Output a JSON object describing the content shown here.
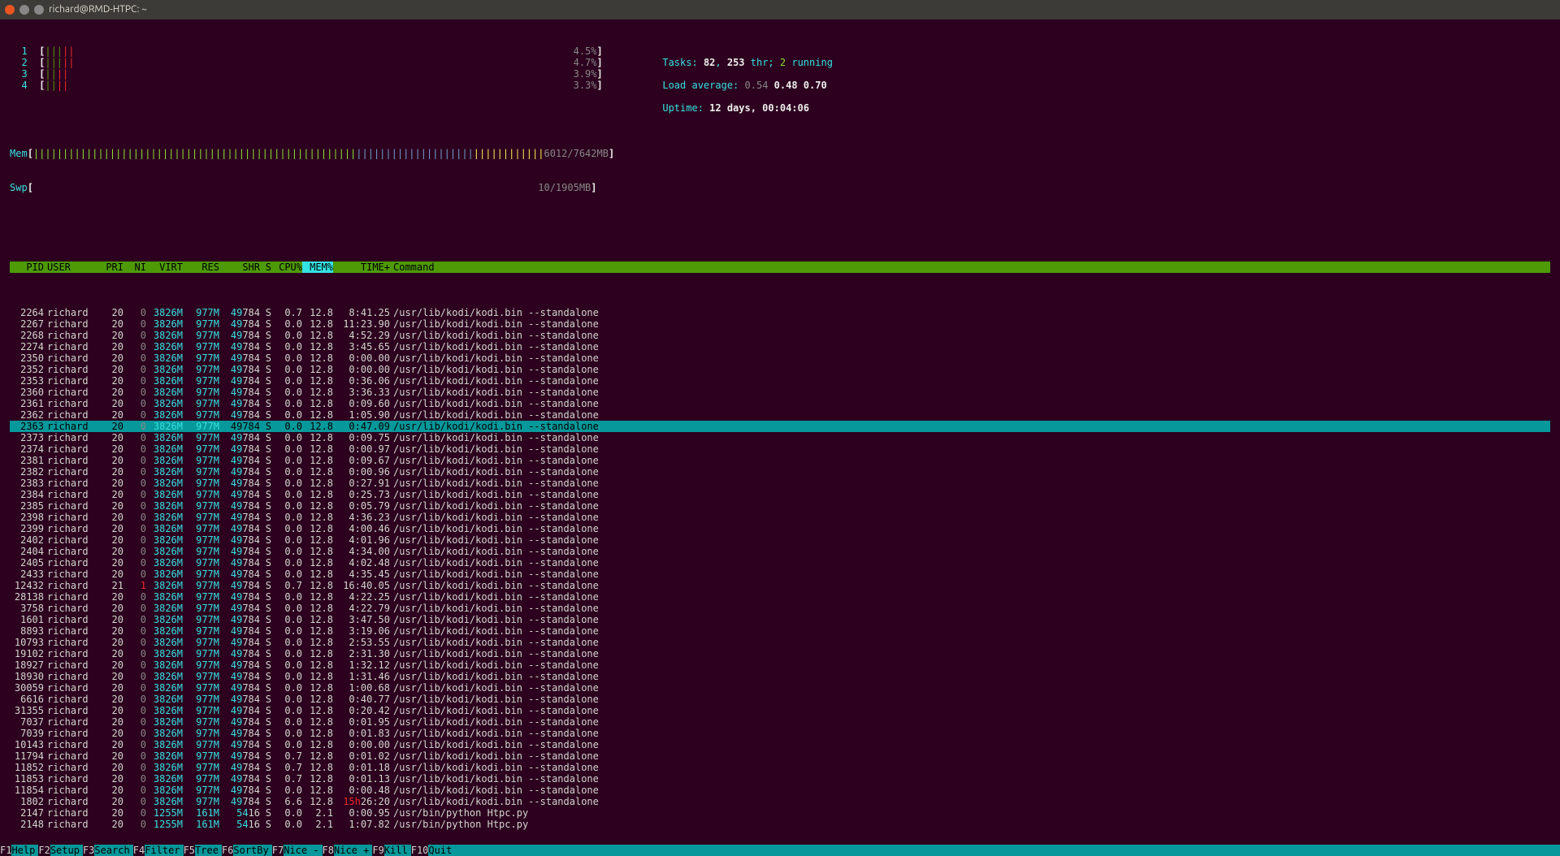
{
  "window": {
    "title": "richard@RMD-HTPC: ~"
  },
  "meters": {
    "cpus": [
      {
        "num": "1",
        "bars": "|||||",
        "pct": "4.5%"
      },
      {
        "num": "2",
        "bars": "|||||",
        "pct": "4.7%"
      },
      {
        "num": "3",
        "bars": "||||",
        "pct": "3.9%"
      },
      {
        "num": "4",
        "bars": "||||",
        "pct": "3.3%"
      }
    ],
    "mem": {
      "label": "Mem",
      "val": "6012/7642MB"
    },
    "swp": {
      "label": "Swp",
      "val": "10/1905MB"
    },
    "tasks": {
      "label": "Tasks: ",
      "total": "82",
      "sep": ", ",
      "thr": "253",
      "thrlbl": " thr; ",
      "run": "2",
      "runlbl": " running"
    },
    "load": {
      "label": "Load average: ",
      "l1": "0.54",
      "l2": "0.48",
      "l3": "0.70"
    },
    "uptime": {
      "label": "Uptime: ",
      "val": "12 days, 00:04:06"
    }
  },
  "headers": {
    "pid": "PID",
    "user": "USER",
    "pri": "PRI",
    "ni": "NI",
    "virt": "VIRT",
    "res": "RES",
    "shr": "SHR",
    "s": "S",
    "cpu": "CPU%",
    "mem": "MEM%",
    "time": "TIME+",
    "cmd": "Command"
  },
  "processes": [
    {
      "pid": "2264",
      "user": "richard",
      "pri": "20",
      "ni": "0",
      "virt": "3826M",
      "res": "977M",
      "shr": "49784",
      "s": "S",
      "cpu": "0.7",
      "mem": "12.8",
      "time": "8:41.25",
      "cmd": "/usr/lib/kodi/kodi.bin --standalone"
    },
    {
      "pid": "2267",
      "user": "richard",
      "pri": "20",
      "ni": "0",
      "virt": "3826M",
      "res": "977M",
      "shr": "49784",
      "s": "S",
      "cpu": "0.0",
      "mem": "12.8",
      "time": "11:23.90",
      "cmd": "/usr/lib/kodi/kodi.bin --standalone"
    },
    {
      "pid": "2268",
      "user": "richard",
      "pri": "20",
      "ni": "0",
      "virt": "3826M",
      "res": "977M",
      "shr": "49784",
      "s": "S",
      "cpu": "0.0",
      "mem": "12.8",
      "time": "4:52.29",
      "cmd": "/usr/lib/kodi/kodi.bin --standalone"
    },
    {
      "pid": "2274",
      "user": "richard",
      "pri": "20",
      "ni": "0",
      "virt": "3826M",
      "res": "977M",
      "shr": "49784",
      "s": "S",
      "cpu": "0.0",
      "mem": "12.8",
      "time": "3:45.65",
      "cmd": "/usr/lib/kodi/kodi.bin --standalone"
    },
    {
      "pid": "2350",
      "user": "richard",
      "pri": "20",
      "ni": "0",
      "virt": "3826M",
      "res": "977M",
      "shr": "49784",
      "s": "S",
      "cpu": "0.0",
      "mem": "12.8",
      "time": "0:00.00",
      "cmd": "/usr/lib/kodi/kodi.bin --standalone"
    },
    {
      "pid": "2352",
      "user": "richard",
      "pri": "20",
      "ni": "0",
      "virt": "3826M",
      "res": "977M",
      "shr": "49784",
      "s": "S",
      "cpu": "0.0",
      "mem": "12.8",
      "time": "0:00.00",
      "cmd": "/usr/lib/kodi/kodi.bin --standalone"
    },
    {
      "pid": "2353",
      "user": "richard",
      "pri": "20",
      "ni": "0",
      "virt": "3826M",
      "res": "977M",
      "shr": "49784",
      "s": "S",
      "cpu": "0.0",
      "mem": "12.8",
      "time": "0:36.06",
      "cmd": "/usr/lib/kodi/kodi.bin --standalone"
    },
    {
      "pid": "2360",
      "user": "richard",
      "pri": "20",
      "ni": "0",
      "virt": "3826M",
      "res": "977M",
      "shr": "49784",
      "s": "S",
      "cpu": "0.0",
      "mem": "12.8",
      "time": "3:36.33",
      "cmd": "/usr/lib/kodi/kodi.bin --standalone"
    },
    {
      "pid": "2361",
      "user": "richard",
      "pri": "20",
      "ni": "0",
      "virt": "3826M",
      "res": "977M",
      "shr": "49784",
      "s": "S",
      "cpu": "0.0",
      "mem": "12.8",
      "time": "0:09.60",
      "cmd": "/usr/lib/kodi/kodi.bin --standalone"
    },
    {
      "pid": "2362",
      "user": "richard",
      "pri": "20",
      "ni": "0",
      "virt": "3826M",
      "res": "977M",
      "shr": "49784",
      "s": "S",
      "cpu": "0.0",
      "mem": "12.8",
      "time": "1:05.90",
      "cmd": "/usr/lib/kodi/kodi.bin --standalone"
    },
    {
      "pid": "2363",
      "user": "richard",
      "pri": "20",
      "ni": "0",
      "virt": "3826M",
      "res": "977M",
      "shr": "49784",
      "s": "S",
      "cpu": "0.0",
      "mem": "12.8",
      "time": "0:47.09",
      "cmd": "/usr/lib/kodi/kodi.bin --standalone",
      "sel": true
    },
    {
      "pid": "2373",
      "user": "richard",
      "pri": "20",
      "ni": "0",
      "virt": "3826M",
      "res": "977M",
      "shr": "49784",
      "s": "S",
      "cpu": "0.0",
      "mem": "12.8",
      "time": "0:09.75",
      "cmd": "/usr/lib/kodi/kodi.bin --standalone"
    },
    {
      "pid": "2374",
      "user": "richard",
      "pri": "20",
      "ni": "0",
      "virt": "3826M",
      "res": "977M",
      "shr": "49784",
      "s": "S",
      "cpu": "0.0",
      "mem": "12.8",
      "time": "0:00.97",
      "cmd": "/usr/lib/kodi/kodi.bin --standalone"
    },
    {
      "pid": "2381",
      "user": "richard",
      "pri": "20",
      "ni": "0",
      "virt": "3826M",
      "res": "977M",
      "shr": "49784",
      "s": "S",
      "cpu": "0.0",
      "mem": "12.8",
      "time": "0:09.67",
      "cmd": "/usr/lib/kodi/kodi.bin --standalone"
    },
    {
      "pid": "2382",
      "user": "richard",
      "pri": "20",
      "ni": "0",
      "virt": "3826M",
      "res": "977M",
      "shr": "49784",
      "s": "S",
      "cpu": "0.0",
      "mem": "12.8",
      "time": "0:00.96",
      "cmd": "/usr/lib/kodi/kodi.bin --standalone"
    },
    {
      "pid": "2383",
      "user": "richard",
      "pri": "20",
      "ni": "0",
      "virt": "3826M",
      "res": "977M",
      "shr": "49784",
      "s": "S",
      "cpu": "0.0",
      "mem": "12.8",
      "time": "0:27.91",
      "cmd": "/usr/lib/kodi/kodi.bin --standalone"
    },
    {
      "pid": "2384",
      "user": "richard",
      "pri": "20",
      "ni": "0",
      "virt": "3826M",
      "res": "977M",
      "shr": "49784",
      "s": "S",
      "cpu": "0.0",
      "mem": "12.8",
      "time": "0:25.73",
      "cmd": "/usr/lib/kodi/kodi.bin --standalone"
    },
    {
      "pid": "2385",
      "user": "richard",
      "pri": "20",
      "ni": "0",
      "virt": "3826M",
      "res": "977M",
      "shr": "49784",
      "s": "S",
      "cpu": "0.0",
      "mem": "12.8",
      "time": "0:05.79",
      "cmd": "/usr/lib/kodi/kodi.bin --standalone"
    },
    {
      "pid": "2398",
      "user": "richard",
      "pri": "20",
      "ni": "0",
      "virt": "3826M",
      "res": "977M",
      "shr": "49784",
      "s": "S",
      "cpu": "0.0",
      "mem": "12.8",
      "time": "4:36.23",
      "cmd": "/usr/lib/kodi/kodi.bin --standalone"
    },
    {
      "pid": "2399",
      "user": "richard",
      "pri": "20",
      "ni": "0",
      "virt": "3826M",
      "res": "977M",
      "shr": "49784",
      "s": "S",
      "cpu": "0.0",
      "mem": "12.8",
      "time": "4:00.46",
      "cmd": "/usr/lib/kodi/kodi.bin --standalone"
    },
    {
      "pid": "2402",
      "user": "richard",
      "pri": "20",
      "ni": "0",
      "virt": "3826M",
      "res": "977M",
      "shr": "49784",
      "s": "S",
      "cpu": "0.0",
      "mem": "12.8",
      "time": "4:01.96",
      "cmd": "/usr/lib/kodi/kodi.bin --standalone"
    },
    {
      "pid": "2404",
      "user": "richard",
      "pri": "20",
      "ni": "0",
      "virt": "3826M",
      "res": "977M",
      "shr": "49784",
      "s": "S",
      "cpu": "0.0",
      "mem": "12.8",
      "time": "4:34.00",
      "cmd": "/usr/lib/kodi/kodi.bin --standalone"
    },
    {
      "pid": "2405",
      "user": "richard",
      "pri": "20",
      "ni": "0",
      "virt": "3826M",
      "res": "977M",
      "shr": "49784",
      "s": "S",
      "cpu": "0.0",
      "mem": "12.8",
      "time": "4:02.48",
      "cmd": "/usr/lib/kodi/kodi.bin --standalone"
    },
    {
      "pid": "2433",
      "user": "richard",
      "pri": "20",
      "ni": "0",
      "virt": "3826M",
      "res": "977M",
      "shr": "49784",
      "s": "S",
      "cpu": "0.0",
      "mem": "12.8",
      "time": "4:35.45",
      "cmd": "/usr/lib/kodi/kodi.bin --standalone"
    },
    {
      "pid": "12432",
      "user": "richard",
      "pri": "21",
      "ni": "1",
      "virt": "3826M",
      "res": "977M",
      "shr": "49784",
      "s": "S",
      "cpu": "0.7",
      "mem": "12.8",
      "time": "16:40.05",
      "cmd": "/usr/lib/kodi/kodi.bin --standalone",
      "nice": true
    },
    {
      "pid": "28138",
      "user": "richard",
      "pri": "20",
      "ni": "0",
      "virt": "3826M",
      "res": "977M",
      "shr": "49784",
      "s": "S",
      "cpu": "0.0",
      "mem": "12.8",
      "time": "4:22.25",
      "cmd": "/usr/lib/kodi/kodi.bin --standalone"
    },
    {
      "pid": "3758",
      "user": "richard",
      "pri": "20",
      "ni": "0",
      "virt": "3826M",
      "res": "977M",
      "shr": "49784",
      "s": "S",
      "cpu": "0.0",
      "mem": "12.8",
      "time": "4:22.79",
      "cmd": "/usr/lib/kodi/kodi.bin --standalone"
    },
    {
      "pid": "1601",
      "user": "richard",
      "pri": "20",
      "ni": "0",
      "virt": "3826M",
      "res": "977M",
      "shr": "49784",
      "s": "S",
      "cpu": "0.0",
      "mem": "12.8",
      "time": "3:47.50",
      "cmd": "/usr/lib/kodi/kodi.bin --standalone"
    },
    {
      "pid": "8893",
      "user": "richard",
      "pri": "20",
      "ni": "0",
      "virt": "3826M",
      "res": "977M",
      "shr": "49784",
      "s": "S",
      "cpu": "0.0",
      "mem": "12.8",
      "time": "3:19.06",
      "cmd": "/usr/lib/kodi/kodi.bin --standalone"
    },
    {
      "pid": "10793",
      "user": "richard",
      "pri": "20",
      "ni": "0",
      "virt": "3826M",
      "res": "977M",
      "shr": "49784",
      "s": "S",
      "cpu": "0.0",
      "mem": "12.8",
      "time": "2:53.55",
      "cmd": "/usr/lib/kodi/kodi.bin --standalone"
    },
    {
      "pid": "19102",
      "user": "richard",
      "pri": "20",
      "ni": "0",
      "virt": "3826M",
      "res": "977M",
      "shr": "49784",
      "s": "S",
      "cpu": "0.0",
      "mem": "12.8",
      "time": "2:31.30",
      "cmd": "/usr/lib/kodi/kodi.bin --standalone"
    },
    {
      "pid": "18927",
      "user": "richard",
      "pri": "20",
      "ni": "0",
      "virt": "3826M",
      "res": "977M",
      "shr": "49784",
      "s": "S",
      "cpu": "0.0",
      "mem": "12.8",
      "time": "1:32.12",
      "cmd": "/usr/lib/kodi/kodi.bin --standalone"
    },
    {
      "pid": "18930",
      "user": "richard",
      "pri": "20",
      "ni": "0",
      "virt": "3826M",
      "res": "977M",
      "shr": "49784",
      "s": "S",
      "cpu": "0.0",
      "mem": "12.8",
      "time": "1:31.46",
      "cmd": "/usr/lib/kodi/kodi.bin --standalone"
    },
    {
      "pid": "30059",
      "user": "richard",
      "pri": "20",
      "ni": "0",
      "virt": "3826M",
      "res": "977M",
      "shr": "49784",
      "s": "S",
      "cpu": "0.0",
      "mem": "12.8",
      "time": "1:00.68",
      "cmd": "/usr/lib/kodi/kodi.bin --standalone"
    },
    {
      "pid": "6616",
      "user": "richard",
      "pri": "20",
      "ni": "0",
      "virt": "3826M",
      "res": "977M",
      "shr": "49784",
      "s": "S",
      "cpu": "0.0",
      "mem": "12.8",
      "time": "0:40.77",
      "cmd": "/usr/lib/kodi/kodi.bin --standalone"
    },
    {
      "pid": "31355",
      "user": "richard",
      "pri": "20",
      "ni": "0",
      "virt": "3826M",
      "res": "977M",
      "shr": "49784",
      "s": "S",
      "cpu": "0.0",
      "mem": "12.8",
      "time": "0:20.42",
      "cmd": "/usr/lib/kodi/kodi.bin --standalone"
    },
    {
      "pid": "7037",
      "user": "richard",
      "pri": "20",
      "ni": "0",
      "virt": "3826M",
      "res": "977M",
      "shr": "49784",
      "s": "S",
      "cpu": "0.0",
      "mem": "12.8",
      "time": "0:01.95",
      "cmd": "/usr/lib/kodi/kodi.bin --standalone"
    },
    {
      "pid": "7039",
      "user": "richard",
      "pri": "20",
      "ni": "0",
      "virt": "3826M",
      "res": "977M",
      "shr": "49784",
      "s": "S",
      "cpu": "0.0",
      "mem": "12.8",
      "time": "0:01.83",
      "cmd": "/usr/lib/kodi/kodi.bin --standalone"
    },
    {
      "pid": "10143",
      "user": "richard",
      "pri": "20",
      "ni": "0",
      "virt": "3826M",
      "res": "977M",
      "shr": "49784",
      "s": "S",
      "cpu": "0.0",
      "mem": "12.8",
      "time": "0:00.00",
      "cmd": "/usr/lib/kodi/kodi.bin --standalone"
    },
    {
      "pid": "11794",
      "user": "richard",
      "pri": "20",
      "ni": "0",
      "virt": "3826M",
      "res": "977M",
      "shr": "49784",
      "s": "S",
      "cpu": "0.7",
      "mem": "12.8",
      "time": "0:01.02",
      "cmd": "/usr/lib/kodi/kodi.bin --standalone"
    },
    {
      "pid": "11852",
      "user": "richard",
      "pri": "20",
      "ni": "0",
      "virt": "3826M",
      "res": "977M",
      "shr": "49784",
      "s": "S",
      "cpu": "0.7",
      "mem": "12.8",
      "time": "0:01.18",
      "cmd": "/usr/lib/kodi/kodi.bin --standalone"
    },
    {
      "pid": "11853",
      "user": "richard",
      "pri": "20",
      "ni": "0",
      "virt": "3826M",
      "res": "977M",
      "shr": "49784",
      "s": "S",
      "cpu": "0.7",
      "mem": "12.8",
      "time": "0:01.13",
      "cmd": "/usr/lib/kodi/kodi.bin --standalone"
    },
    {
      "pid": "11854",
      "user": "richard",
      "pri": "20",
      "ni": "0",
      "virt": "3826M",
      "res": "977M",
      "shr": "49784",
      "s": "S",
      "cpu": "0.0",
      "mem": "12.8",
      "time": "0:00.48",
      "cmd": "/usr/lib/kodi/kodi.bin --standalone"
    },
    {
      "pid": "1802",
      "user": "richard",
      "pri": "20",
      "ni": "0",
      "virt": "3826M",
      "res": "977M",
      "shr": "49784",
      "s": "S",
      "cpu": "6.6",
      "mem": "12.8",
      "time": "26:20",
      "cmd": "/usr/lib/kodi/kodi.bin --standalone",
      "timepre": "15h"
    },
    {
      "pid": "2147",
      "user": "richard",
      "pri": "20",
      "ni": "0",
      "virt": "1255M",
      "res": "161M",
      "shr": "5416",
      "s": "S",
      "cpu": "0.0",
      "mem": "2.1",
      "time": "0:00.95",
      "cmd": "/usr/bin/python Htpc.py"
    },
    {
      "pid": "2148",
      "user": "richard",
      "pri": "20",
      "ni": "0",
      "virt": "1255M",
      "res": "161M",
      "shr": "5416",
      "s": "S",
      "cpu": "0.0",
      "mem": "2.1",
      "time": "1:07.82",
      "cmd": "/usr/bin/python Htpc.py"
    }
  ],
  "footer": [
    {
      "key": "F1",
      "label": "Help"
    },
    {
      "key": "F2",
      "label": "Setup"
    },
    {
      "key": "F3",
      "label": "Search"
    },
    {
      "key": "F4",
      "label": "Filter"
    },
    {
      "key": "F5",
      "label": "Tree"
    },
    {
      "key": "F6",
      "label": "SortBy"
    },
    {
      "key": "F7",
      "label": "Nice -"
    },
    {
      "key": "F8",
      "label": "Nice +"
    },
    {
      "key": "F9",
      "label": "Kill"
    },
    {
      "key": "F10",
      "label": "Quit"
    }
  ]
}
